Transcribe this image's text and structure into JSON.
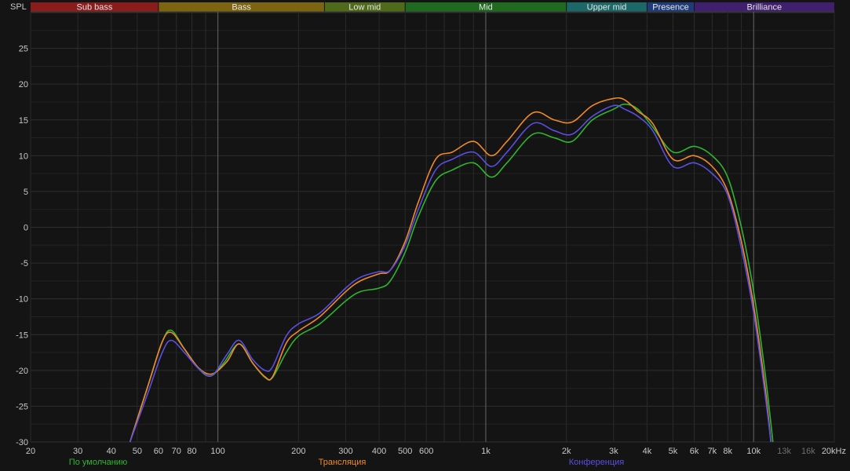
{
  "chart_data": {
    "type": "line",
    "ylabel": "SPL",
    "xscale": "log",
    "xlim": [
      20,
      20000
    ],
    "ylim": [
      -30,
      30
    ],
    "yticks": [
      -30,
      -25,
      -20,
      -15,
      -10,
      -5,
      0,
      5,
      10,
      15,
      20,
      25
    ],
    "xticks": [
      {
        "value": 20,
        "label": "20"
      },
      {
        "value": 30,
        "label": "30"
      },
      {
        "value": 40,
        "label": "40"
      },
      {
        "value": 50,
        "label": "50"
      },
      {
        "value": 60,
        "label": "60"
      },
      {
        "value": 70,
        "label": "70"
      },
      {
        "value": 80,
        "label": "80"
      },
      {
        "value": 100,
        "label": "100"
      },
      {
        "value": 200,
        "label": "200"
      },
      {
        "value": 300,
        "label": "300"
      },
      {
        "value": 400,
        "label": "400"
      },
      {
        "value": 500,
        "label": "500"
      },
      {
        "value": 600,
        "label": "600"
      },
      {
        "value": 1000,
        "label": "1k"
      },
      {
        "value": 2000,
        "label": "2k"
      },
      {
        "value": 3000,
        "label": "3k"
      },
      {
        "value": 4000,
        "label": "4k"
      },
      {
        "value": 5000,
        "label": "5k"
      },
      {
        "value": 6000,
        "label": "6k"
      },
      {
        "value": 7000,
        "label": "7k"
      },
      {
        "value": 8000,
        "label": "8k"
      },
      {
        "value": 10000,
        "label": "10k"
      },
      {
        "value": 13000,
        "label": "13k",
        "dim": true
      },
      {
        "value": 16000,
        "label": "16k",
        "dim": true
      },
      {
        "value": 20000,
        "label": "20kHz"
      }
    ],
    "grid": true,
    "bands": [
      {
        "name": "Sub bass",
        "from": 20,
        "to": 60,
        "color": "#8b1c1c"
      },
      {
        "name": "Bass",
        "from": 60,
        "to": 250,
        "color": "#7d6410"
      },
      {
        "name": "Low mid",
        "from": 250,
        "to": 500,
        "color": "#4f6a1a"
      },
      {
        "name": "Mid",
        "from": 500,
        "to": 2000,
        "color": "#1f6a1f"
      },
      {
        "name": "Upper mid",
        "from": 2000,
        "to": 4000,
        "color": "#1c6767"
      },
      {
        "name": "Presence",
        "from": 4000,
        "to": 6000,
        "color": "#1f3b7a"
      },
      {
        "name": "Brilliance",
        "from": 6000,
        "to": 20000,
        "color": "#3f1f6e"
      }
    ],
    "series": [
      {
        "name": "По умолчанию",
        "color": "#2fb52f",
        "x": [
          47,
          55,
          62,
          67,
          75,
          85,
          94,
          105,
          120,
          135,
          150,
          160,
          180,
          200,
          240,
          300,
          340,
          400,
          440,
          500,
          560,
          650,
          750,
          900,
          1050,
          1200,
          1500,
          1800,
          2100,
          2500,
          3000,
          3300,
          3700,
          4200,
          5000,
          6000,
          7000,
          8000,
          9000,
          10000,
          11000,
          11800
        ],
        "values": [
          -30,
          -22,
          -16,
          -14.4,
          -17,
          -19.8,
          -20.8,
          -19,
          -16.3,
          -19,
          -21,
          -21,
          -17.5,
          -15.2,
          -13.5,
          -10.3,
          -9,
          -8.5,
          -7.5,
          -3.5,
          1.5,
          6.5,
          8,
          9,
          7,
          9,
          13,
          12.5,
          12,
          15,
          16.5,
          17.2,
          16.5,
          14,
          10.5,
          11.3,
          10,
          7,
          0,
          -9,
          -20,
          -30
        ]
      },
      {
        "name": "Трансляция",
        "color": "#f0892a",
        "x": [
          47,
          55,
          62,
          67,
          75,
          85,
          95,
          108,
          120,
          135,
          150,
          160,
          180,
          200,
          240,
          300,
          340,
          400,
          440,
          500,
          560,
          650,
          750,
          900,
          1050,
          1200,
          1500,
          1800,
          2100,
          2500,
          3000,
          3300,
          3700,
          4200,
          5000,
          6000,
          7000,
          8000,
          9000,
          10000,
          11000,
          11600
        ],
        "values": [
          -30,
          -22,
          -16,
          -14.7,
          -17,
          -19.7,
          -20.5,
          -18.8,
          -16.3,
          -19,
          -20.9,
          -20.9,
          -16.2,
          -14.5,
          -12.5,
          -9,
          -7.5,
          -6.5,
          -6,
          -2,
          3.5,
          9.5,
          10.5,
          12,
          10,
          12,
          16,
          15,
          14.7,
          17,
          18,
          17.8,
          16.2,
          14.5,
          9.5,
          10,
          8.5,
          5,
          -2,
          -11,
          -22,
          -30
        ]
      },
      {
        "name": "Конференция",
        "color": "#5a4fe0",
        "x": [
          47,
          55,
          62,
          67,
          75,
          85,
          95,
          108,
          120,
          135,
          150,
          160,
          180,
          200,
          240,
          300,
          340,
          400,
          440,
          500,
          560,
          650,
          750,
          900,
          1050,
          1200,
          1500,
          1800,
          2100,
          2500,
          3000,
          3300,
          3700,
          4200,
          5000,
          6000,
          7000,
          8000,
          9000,
          10000,
          11000,
          11600
        ],
        "values": [
          -30,
          -23,
          -17.5,
          -15.8,
          -17.5,
          -19.8,
          -20.7,
          -17.8,
          -15.8,
          -18.5,
          -20,
          -19.5,
          -15.2,
          -13.5,
          -12,
          -8.5,
          -7,
          -6.2,
          -6,
          -2.5,
          2.5,
          8,
          9.5,
          10.5,
          8.5,
          10.5,
          14.5,
          13.5,
          13,
          15.5,
          17,
          16.5,
          15.5,
          13.5,
          8.5,
          9,
          7.5,
          4.5,
          -3,
          -12,
          -23,
          -30
        ]
      }
    ]
  }
}
